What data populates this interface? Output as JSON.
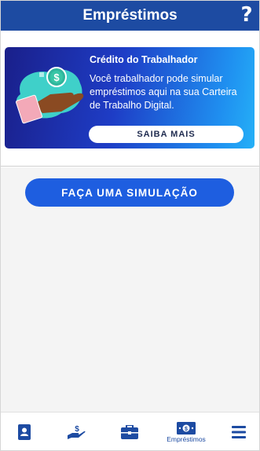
{
  "header": {
    "title": "Empréstimos",
    "help_label": "?"
  },
  "banner": {
    "title": "Crédito do Trabalhador",
    "text": "Você trabalhador pode simular empréstimos aqui na sua Carteira de Trabalho Digital.",
    "button_label": "SAIBA MAIS",
    "illustration_icon": "hand-with-coin-icon"
  },
  "simulate_button": {
    "label": "FAÇA UMA SIMULAÇÃO"
  },
  "tabbar": {
    "items": [
      {
        "icon": "id-card-icon",
        "label": ""
      },
      {
        "icon": "hand-money-icon",
        "label": ""
      },
      {
        "icon": "briefcase-icon",
        "label": ""
      },
      {
        "icon": "banknote-icon",
        "label": "Empréstimos",
        "active": true
      },
      {
        "icon": "menu-icon",
        "label": ""
      }
    ]
  },
  "colors": {
    "header_bg": "#1d4ba2",
    "button_blue": "#1e5ee0",
    "banner_dark": "#1a1f8a",
    "banner_light": "#25b0f7"
  }
}
